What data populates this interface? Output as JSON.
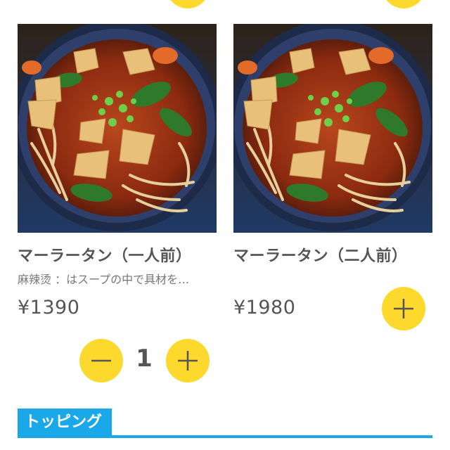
{
  "theme": {
    "button_color": "#fcd92c",
    "section_color": "#1aa8e8",
    "text_color": "#555555"
  },
  "menu": {
    "items": [
      {
        "name": "マーラータン（一人前）",
        "description": "麻辣烫 ：はスープの中で具材を…",
        "price": "¥1390",
        "quantity": "1",
        "image": "malatang-bowl-photo"
      },
      {
        "name": "マーラータン（二人前）",
        "description": "",
        "price": "¥1980",
        "image": "malatang-bowl-photo"
      }
    ]
  },
  "section": {
    "title": "トッピング"
  },
  "icons": {
    "add": "plus-icon",
    "remove": "minus-icon"
  }
}
